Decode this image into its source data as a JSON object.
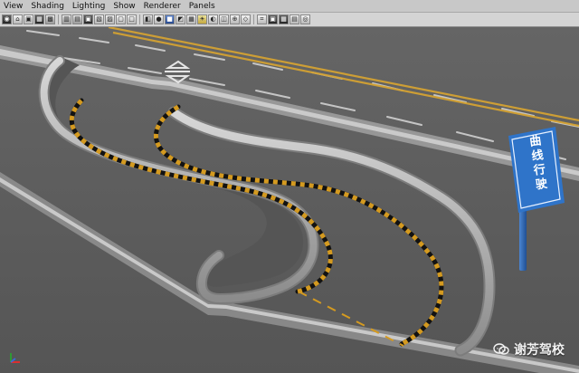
{
  "menu": {
    "items": [
      "View",
      "Shading",
      "Lighting",
      "Show",
      "Renderer",
      "Panels"
    ]
  },
  "toolbar": {
    "buttons": [
      "camera-attributes-icon",
      "camera-icon",
      "bookmark-icon",
      "image-plane-icon",
      "2d-pan-zoom-icon",
      "grid-icon",
      "film-gate-icon",
      "resolution-gate-icon",
      "gate-mask-icon",
      "field-chart-icon",
      "safe-action-icon",
      "safe-title-icon",
      "wireframe-icon",
      "smooth-shade-icon",
      "use-default-material-icon",
      "wireframe-on-shaded-icon",
      "textured-icon",
      "use-all-lights-icon",
      "shadows-icon",
      "xray-icon",
      "xray-joints-icon",
      "backface-culling-icon",
      "isolate-select-icon",
      "render-view-icon",
      "ipr-render-icon",
      "render-settings-icon",
      "hypershade-icon"
    ]
  },
  "sign": {
    "text": "曲线行驶"
  },
  "watermark": {
    "text": "谢芳驾校"
  },
  "colors": {
    "road": "#5a5a5a",
    "curb": "#b8b8b8",
    "curb_shadow": "#7f7f7f",
    "hazard_black": "#151515",
    "hazard_yellow": "#d59a1e",
    "lane_white": "#e7e7e7",
    "lane_yellow": "#d0a033",
    "sign_blue": "#2f74c9",
    "sign_white": "#ffffff",
    "toolbar": "#d4d4d4"
  }
}
